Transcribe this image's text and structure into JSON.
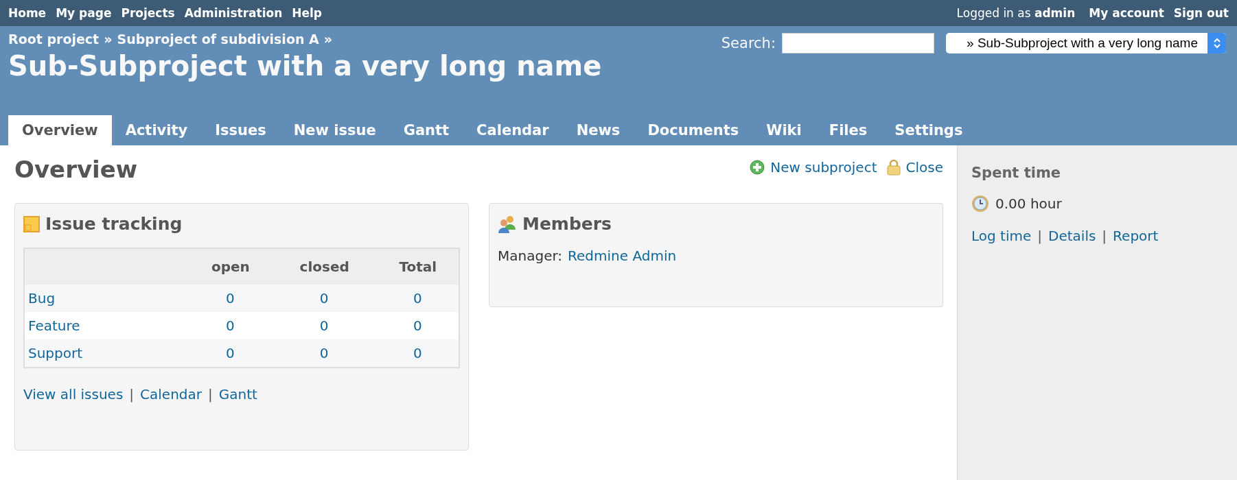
{
  "top_menu": {
    "items": [
      "Home",
      "My page",
      "Projects",
      "Administration",
      "Help"
    ]
  },
  "account": {
    "logged_in": "Logged in as **admin**",
    "links": [
      "My account",
      "Sign out"
    ]
  },
  "header": {
    "breadcrumb": [
      "Root project",
      "Subproject of subdivision A"
    ],
    "separator": "»",
    "title": "Sub-Subproject with a very long name",
    "search": {
      "label": "Search:"
    },
    "project_jump": {
      "value": "» Sub-Subproject with a very long name"
    }
  },
  "tabs": [
    {
      "label": "Overview",
      "selected": true
    },
    {
      "label": "Activity",
      "selected": false
    },
    {
      "label": "Issues",
      "selected": false
    },
    {
      "label": "New issue",
      "selected": false
    },
    {
      "label": "Gantt",
      "selected": false
    },
    {
      "label": "Calendar",
      "selected": false
    },
    {
      "label": "News",
      "selected": false
    },
    {
      "label": "Documents",
      "selected": false
    },
    {
      "label": "Wiki",
      "selected": false
    },
    {
      "label": "Files",
      "selected": false
    },
    {
      "label": "Settings",
      "selected": false
    }
  ],
  "content": {
    "title": "Overview",
    "actions": [
      {
        "kind": "add",
        "label": "New subproject"
      },
      {
        "kind": "lock",
        "label": "Close"
      }
    ]
  },
  "issue_tracking": {
    "title": "Issue tracking",
    "columns": [
      "open",
      "closed",
      "Total"
    ],
    "rows": [
      {
        "tracker": "Bug",
        "open": "0",
        "closed": "0",
        "total": "0"
      },
      {
        "tracker": "Feature",
        "open": "0",
        "closed": "0",
        "total": "0"
      },
      {
        "tracker": "Support",
        "open": "0",
        "closed": "0",
        "total": "0"
      }
    ],
    "links": [
      "View all issues",
      "Calendar",
      "Gantt"
    ],
    "separator": "|"
  },
  "members": {
    "title": "Members",
    "entries": [
      {
        "role": "Manager:",
        "name": "Redmine Admin"
      }
    ]
  },
  "sidebar": {
    "title": "Spent time",
    "hours": "0.00 hour",
    "links": [
      "Log time",
      "Details",
      "Report"
    ],
    "separator": "|"
  }
}
